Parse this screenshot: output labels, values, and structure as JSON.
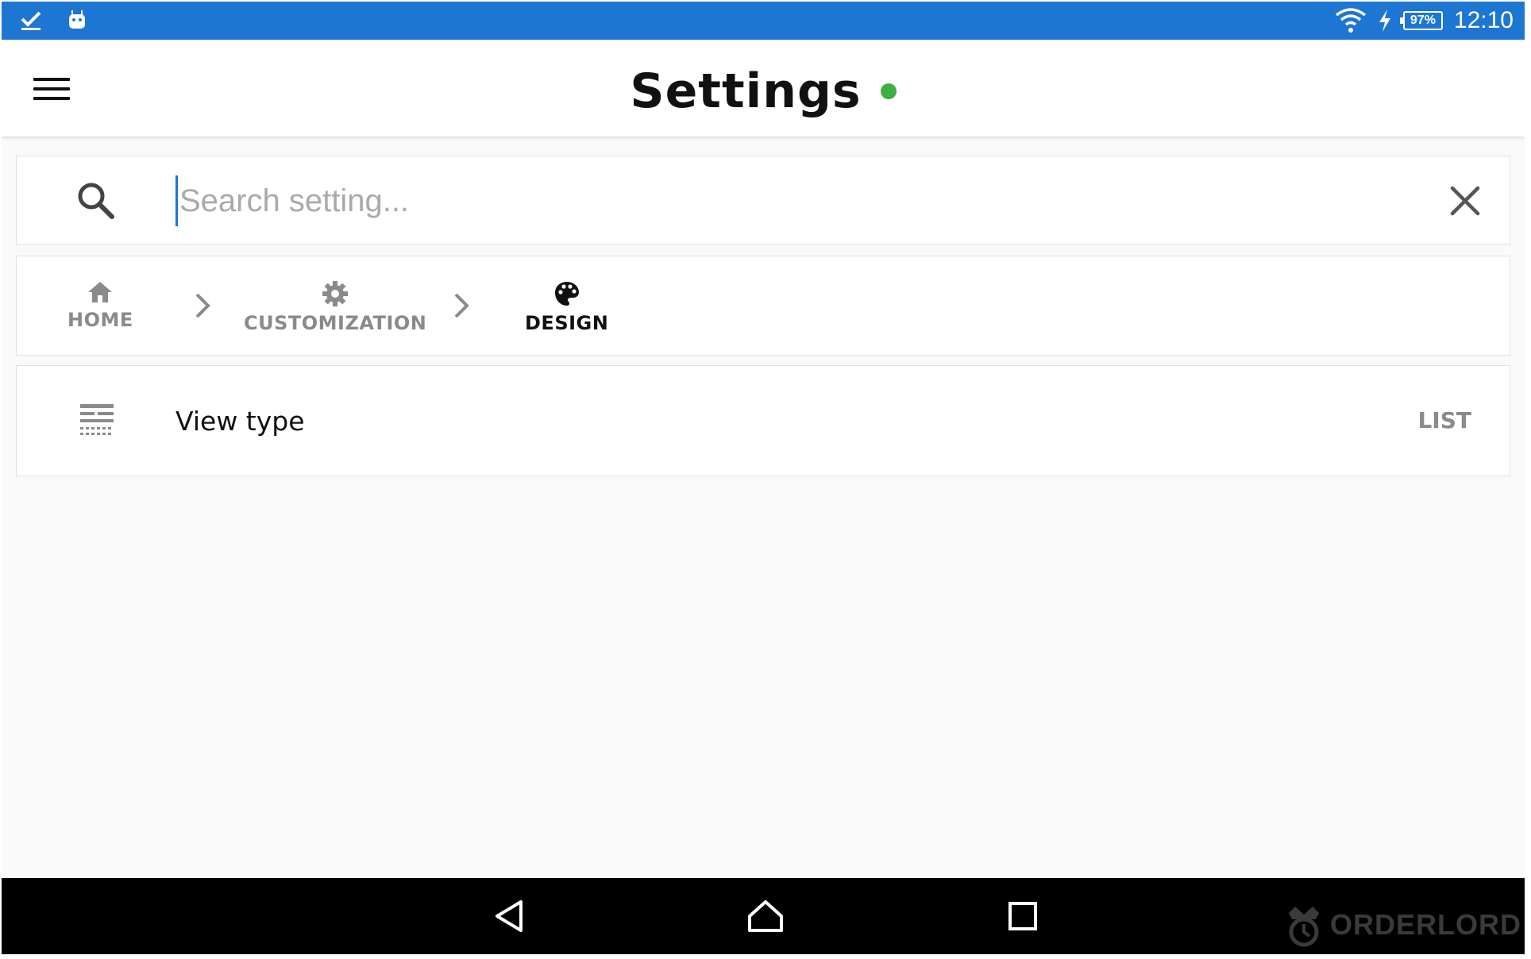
{
  "status_bar": {
    "time": "12:10",
    "battery": "97%",
    "icons": [
      "task-check-icon",
      "android-icon",
      "wifi-icon",
      "charging-icon",
      "battery-icon"
    ],
    "background": "#1e76d3"
  },
  "header": {
    "title": "Settings",
    "status_dot_color": "#3cb043",
    "menu_icon": "hamburger-menu-icon"
  },
  "search": {
    "placeholder": "Search setting...",
    "value": "",
    "icon": "search-icon",
    "clear_icon": "close-icon"
  },
  "breadcrumb": {
    "items": [
      {
        "label": "HOME",
        "icon": "home-icon"
      },
      {
        "label": "CUSTOMIZATION",
        "icon": "gear-icon"
      },
      {
        "label": "DESIGN",
        "icon": "palette-icon",
        "active": true
      }
    ],
    "separator_icon": "chevron-right-icon"
  },
  "settings": {
    "items": [
      {
        "label": "View type",
        "value": "LIST",
        "icon": "view-type-icon"
      }
    ]
  },
  "nav_bar": {
    "buttons": [
      "back-icon",
      "home-icon",
      "recents-icon"
    ],
    "brand": "ORDERLORD"
  }
}
